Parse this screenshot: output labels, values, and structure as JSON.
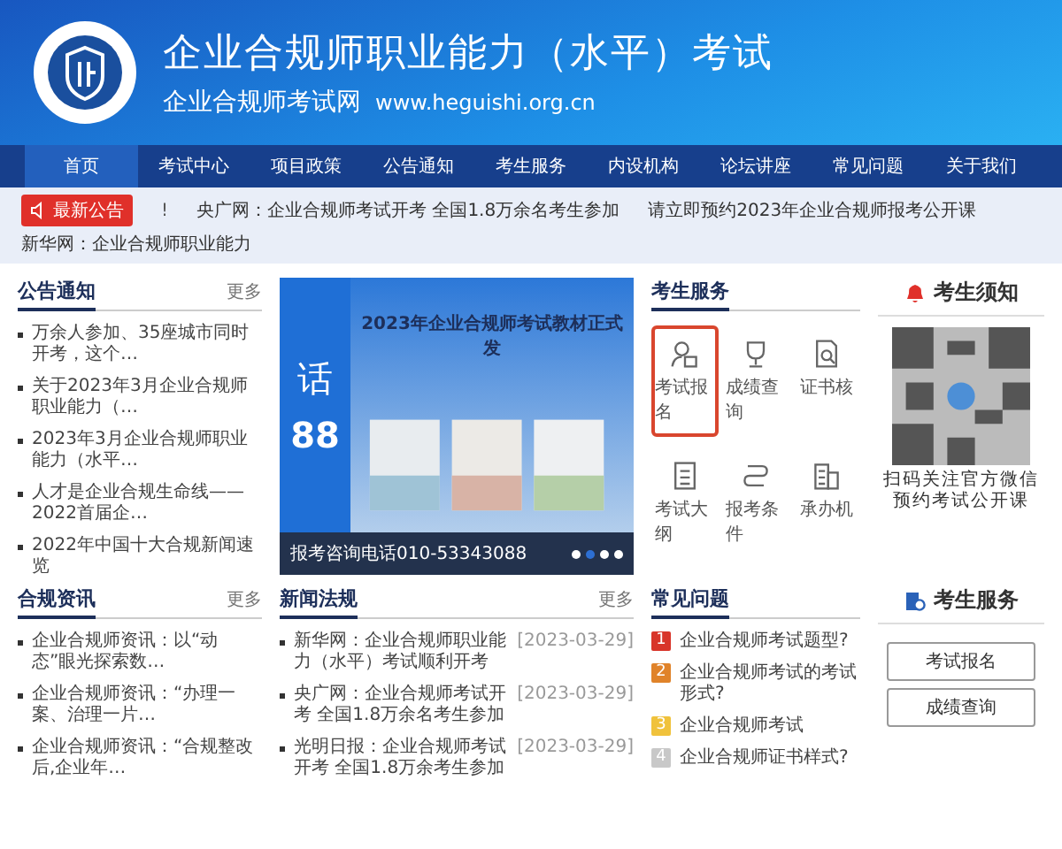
{
  "header": {
    "title": "企业合规师职业能力（水平）考试",
    "site_name": "企业合规师考试网",
    "url": "www.heguishi.org.cn"
  },
  "nav": [
    {
      "label": "首页",
      "selected": true
    },
    {
      "label": "考试中心",
      "selected": false
    },
    {
      "label": "项目政策",
      "selected": false
    },
    {
      "label": "公告通知",
      "selected": false
    },
    {
      "label": "考生服务",
      "selected": false
    },
    {
      "label": "内设机构",
      "selected": false
    },
    {
      "label": "论坛讲座",
      "selected": false
    },
    {
      "label": "常见问题",
      "selected": false
    },
    {
      "label": "关于我们",
      "selected": false
    }
  ],
  "ticker": {
    "badge": "最新公告",
    "mark": "!",
    "items": [
      "央广网：企业合规师考试开考 全国1.8万余名考生参加",
      "请立即预约2023年企业合规师报考公开课",
      "新华网：企业合规师职业能力"
    ]
  },
  "notices": {
    "title": "公告通知",
    "more": "更多",
    "items": [
      "万余人参加、35座城市同时开考，这个…",
      "关于2023年3月企业合规师职业能力（…",
      "2023年3月企业合规师职业能力（水平…",
      "人才是企业合规生命线——2022首届企…",
      "2022年中国十大合规新闻速览"
    ]
  },
  "banner": {
    "headline": "2023年企业合规师考试教材正式发",
    "side_text": "话",
    "side_number": "88",
    "caption": "报考咨询电话010-53343088",
    "dots": [
      {
        "selected": false
      },
      {
        "selected": true
      },
      {
        "selected": false
      },
      {
        "selected": false
      }
    ]
  },
  "services": {
    "title": "考生服务",
    "items": [
      {
        "label": "考试报名",
        "kind": "register",
        "highlighted": true
      },
      {
        "label": "成绩查询",
        "kind": "trophy",
        "highlighted": false
      },
      {
        "label": "证书核",
        "kind": "certificate",
        "highlighted": false
      },
      {
        "label": "考试大纲",
        "kind": "syllabus",
        "highlighted": false
      },
      {
        "label": "报考条件",
        "kind": "route",
        "highlighted": false
      },
      {
        "label": "承办机",
        "kind": "building",
        "highlighted": false
      }
    ]
  },
  "notice_panel": {
    "title": "考生须知",
    "caption": "扫码关注官方微信预约考试公开课"
  },
  "compliance_news": {
    "title": "合规资讯",
    "more": "更多",
    "items": [
      "企业合规师资讯：以“动态”眼光探索数…",
      "企业合规师资讯：“办理一案、治理一片…",
      "企业合规师资讯：“合规整改后,企业年…"
    ]
  },
  "news": {
    "title": "新闻法规",
    "more": "更多",
    "items": [
      {
        "text": "新华网：企业合规师职业能力（水平）考试顺利开考",
        "date": "[2023-03-29]"
      },
      {
        "text": "央广网：企业合规师考试开考 全国1.8万余名考生参加",
        "date": "[2023-03-29]"
      },
      {
        "text": "光明日报：企业合规师考试开考 全国1.8万余考生参加",
        "date": "[2023-03-29]"
      }
    ]
  },
  "faq": {
    "title": "常见问题",
    "items": [
      {
        "number": "1",
        "text": "企业合规师考试题型?",
        "color": "#d8352a"
      },
      {
        "number": "2",
        "text": "企业合规师考试的考试形式?",
        "color": "#e0832a"
      },
      {
        "number": "3",
        "text": "企业合规师考试",
        "color": "#f0c23c"
      },
      {
        "number": "4",
        "text": "企业合规师证书样式?",
        "color": "#c8c8c8"
      }
    ]
  },
  "service_box": {
    "title": "考生服务",
    "buttons": [
      "考试报名",
      "成绩查询"
    ]
  }
}
